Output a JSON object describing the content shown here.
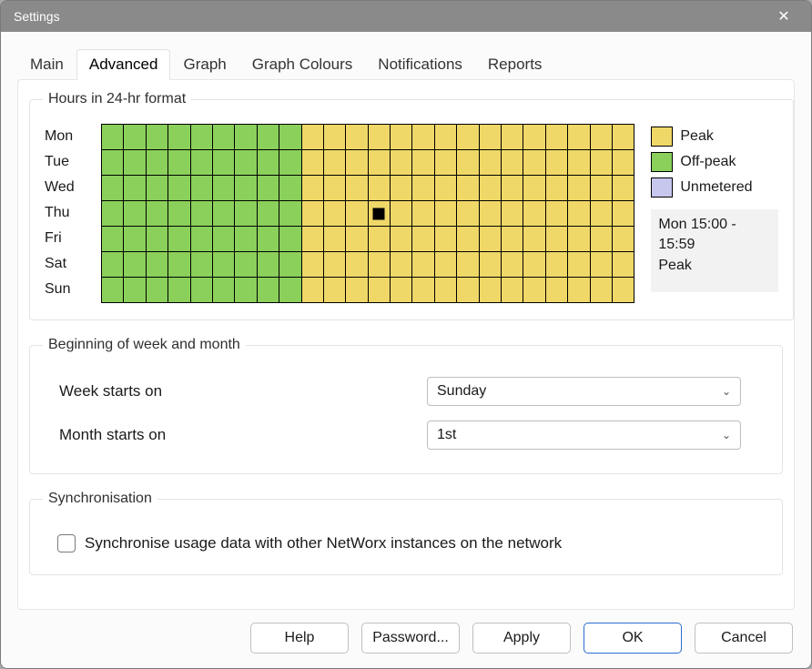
{
  "window": {
    "title": "Settings"
  },
  "tabs": [
    {
      "label": "Main",
      "active": false
    },
    {
      "label": "Advanced",
      "active": true
    },
    {
      "label": "Graph",
      "active": false
    },
    {
      "label": "Graph Colours",
      "active": false
    },
    {
      "label": "Notifications",
      "active": false
    },
    {
      "label": "Reports",
      "active": false
    }
  ],
  "groups": {
    "hours": {
      "legend": "Hours in 24-hr format",
      "days": [
        "Mon",
        "Tue",
        "Wed",
        "Thu",
        "Fri",
        "Sat",
        "Sun"
      ],
      "offpeak_hours": [
        0,
        1,
        2,
        3,
        4,
        5,
        6,
        7,
        8
      ],
      "cursor": {
        "day_index": 3,
        "hour": 12
      },
      "legend_items": [
        {
          "key": "peak",
          "label": "Peak"
        },
        {
          "key": "off",
          "label": "Off-peak"
        },
        {
          "key": "un",
          "label": "Unmetered"
        }
      ],
      "hover": {
        "line1": "Mon 15:00 - 15:59",
        "line2": "Peak"
      }
    },
    "beginning": {
      "legend": "Beginning of week and month",
      "week_label": "Week starts on",
      "week_value": "Sunday",
      "month_label": "Month starts on",
      "month_value": "1st"
    },
    "sync": {
      "legend": "Synchronisation",
      "checkbox_label": "Synchronise usage data with other NetWorx instances on the network",
      "checked": false
    }
  },
  "buttons": {
    "help": "Help",
    "password": "Password...",
    "apply": "Apply",
    "ok": "OK",
    "cancel": "Cancel"
  }
}
